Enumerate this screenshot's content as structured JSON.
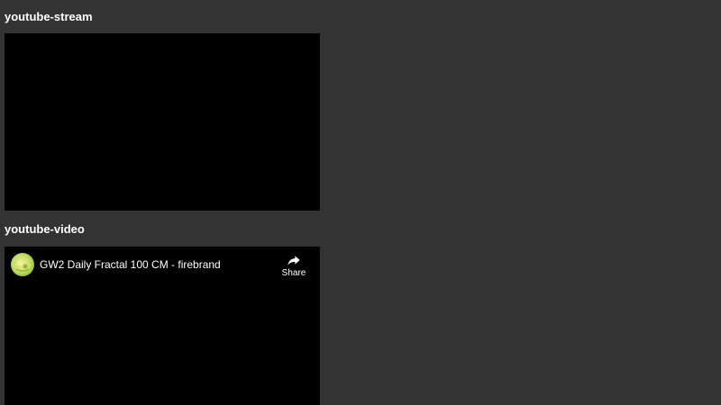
{
  "sections": {
    "stream": {
      "title": "youtube-stream"
    },
    "video": {
      "title": "youtube-video",
      "player": {
        "video_title": "GW2 Daily Fractal 100 CM - firebrand",
        "share_label": "Share",
        "share_icon": "share-arrow-icon",
        "avatar_icon": "channel-avatar"
      }
    }
  },
  "colors": {
    "page_background": "#333333",
    "player_background": "#000000",
    "text": "#ffffff",
    "avatar": "#c7e06a"
  }
}
